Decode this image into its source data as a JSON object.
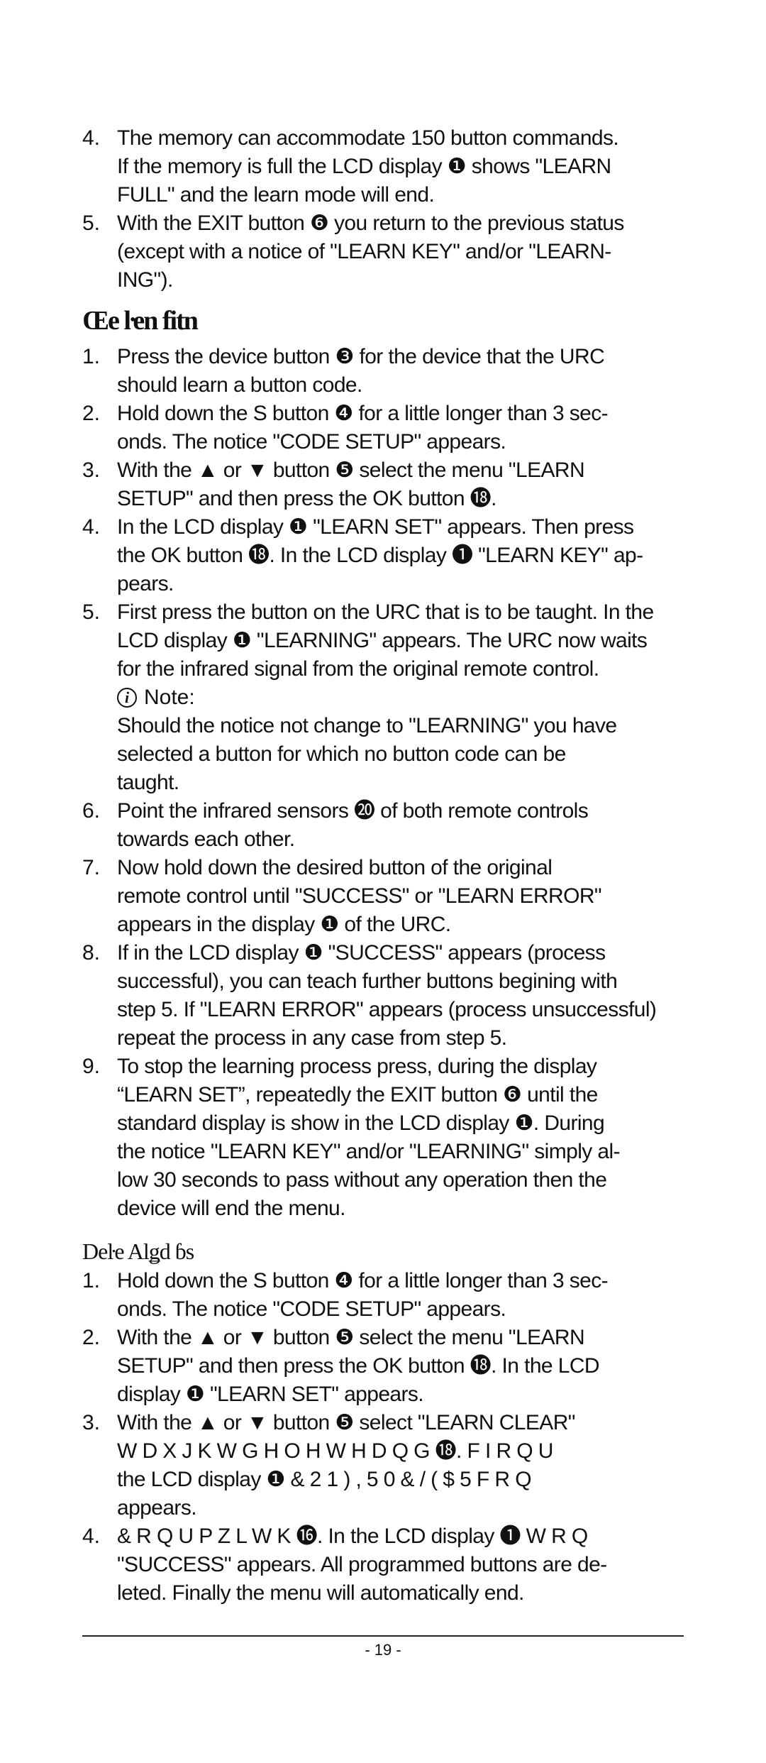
{
  "section1": {
    "items": [
      {
        "num": "4.",
        "lines": [
          "The memory can accommodate 150 button commands.",
          "If the memory is full the LCD display ❶ shows \"LEARN",
          "FULL\" and the learn mode will end."
        ]
      },
      {
        "num": "5.",
        "lines": [
          "With the EXIT button ❻ you return to the previous status",
          "(except with a notice of \"LEARN KEY\" and/or \"LEARN-",
          "ING\")."
        ]
      }
    ]
  },
  "section2": {
    "heading": "Œe ŀen fitn",
    "items": [
      {
        "num": "1.",
        "lines": [
          "Press the device button ❸ for the device that the URC",
          "should learn a button code."
        ]
      },
      {
        "num": "2.",
        "lines": [
          "Hold down the S button ❹ for a little longer than 3 sec-",
          "onds. The notice \"CODE SETUP\" appears."
        ]
      },
      {
        "num": "3.",
        "lines": [
          "With the ▲ or ▼ button ❺ select the menu \"LEARN",
          "SETUP\" and then press the OK button ⓲."
        ]
      },
      {
        "num": "4.",
        "lines": [
          "In the LCD display ❶ \"LEARN SET\" appears. Then press",
          "the OK button ⓲.  In the LCD display ❶ \"LEARN KEY\" ap-",
          "pears."
        ]
      },
      {
        "num": "5.",
        "lines": [
          "First press the button on the URC that is to be taught. In the",
          "LCD display ❶ \"LEARNING\" appears. The URC now waits",
          "for the infrared signal from the original remote control."
        ]
      }
    ],
    "note": {
      "icon": "info-icon",
      "title": "Note:",
      "lines": [
        "Should the notice not change to \"LEARNING\" you have",
        "selected a button for which no button code can be",
        "taught."
      ]
    },
    "items_after": [
      {
        "num": "6.",
        "lines": [
          "Point the infrared sensors ⓴ of both remote controls",
          "towards each other."
        ]
      },
      {
        "num": "7.",
        "lines": [
          "Now hold down the desired button of the original",
          "remote control until \"SUCCESS\" or \"LEARN ERROR\"",
          "appears in the display ❶ of the URC."
        ]
      },
      {
        "num": "8.",
        "lines": [
          "If in the LCD display ❶ \"SUCCESS\" appears (process",
          "successful), you can teach further buttons begining with",
          "step 5. If \"LEARN ERROR\" appears (process unsuccessful)",
          "repeat the process in any case from step 5."
        ]
      },
      {
        "num": "9.",
        "lines": [
          "To stop the learning process press, during the display",
          "“LEARN SET”, repeatedly the EXIT button ❻ until the",
          "standard display is show in the LCD display ❶. During",
          "the notice \"LEARN KEY\" and/or \"LEARNING\" simply al-",
          "low 30 seconds to pass without any operation then the",
          "device will end the menu."
        ]
      }
    ]
  },
  "section3": {
    "heading": "Deŀe Alǥd ɓs",
    "items": [
      {
        "num": "1.",
        "lines": [
          "Hold down the S button ❹ for a little longer than 3 sec-",
          "onds. The notice \"CODE SETUP\" appears."
        ]
      },
      {
        "num": "2.",
        "lines": [
          "With the ▲ or ▼ button ❺ select the menu \"LEARN",
          "SETUP\" and then press the OK button ⓲. In the LCD",
          "display ❶ \"LEARN SET\" appears."
        ]
      },
      {
        "num": "3.",
        "lines": [
          "With the ▲ or ▼ button ❺ select \"LEARN CLEAR\"",
          "W D X J K W   G H O H W H    D Q G ⓲. F I R Q   U",
          "the LCD display ❶     & 2 1 ) , 5 0   & / ( $ 5      F R Q",
          "appears."
        ]
      },
      {
        "num": "4.",
        "lines": [
          "& R Q   U P   Z L W K   ⓰. In the LCD display ❶ W R Q",
          "\"SUCCESS\" appears. All programmed buttons are de-",
          "leted. Finally the menu will automatically end."
        ]
      }
    ]
  },
  "footer": {
    "page_number": "- 19 -"
  }
}
